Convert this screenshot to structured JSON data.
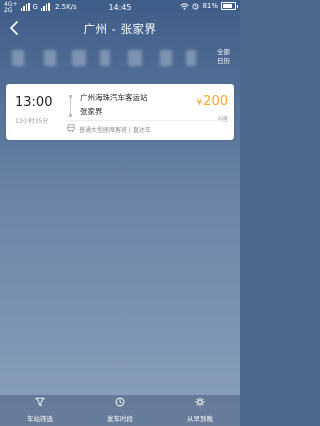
{
  "status_bar": {
    "network_top": "4G+",
    "network_bottom": "2G",
    "carrier_g": "G",
    "speed": "2.5K/s",
    "time": "14:45",
    "battery_percent": "81%",
    "battery_level": 0.81
  },
  "header": {
    "title": "广州 - 张家界"
  },
  "date_strip": {
    "all_dates_line1": "全部",
    "all_dates_line2": "日历"
  },
  "ticket": {
    "departure_time": "13:00",
    "duration": "13小时35分",
    "from_station": "广州海珠汽车客运站",
    "to_station": "张家界",
    "currency": "¥",
    "price": "200",
    "seats": "6座",
    "bus_type": "普通大型座席客班 | 直达车"
  },
  "bottom_tabs": [
    {
      "label": "车站筛选",
      "icon": "filter-icon"
    },
    {
      "label": "发车时段",
      "icon": "clock-icon"
    },
    {
      "label": "从早到晚",
      "icon": "gear-icon"
    }
  ],
  "colors": {
    "accent_price": "#f5a623",
    "background_top": "#3f5d89",
    "background_bottom": "#8aa0bb"
  }
}
